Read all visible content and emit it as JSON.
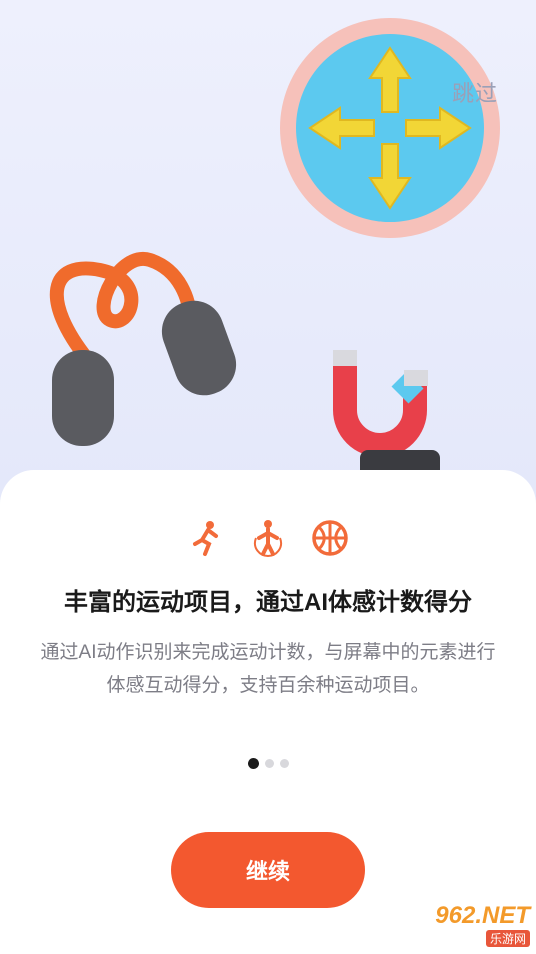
{
  "header": {
    "skip_label": "跳过"
  },
  "feature_icons": [
    "running-icon",
    "jump-rope-icon",
    "basketball-icon"
  ],
  "content": {
    "title": "丰富的运动项目，通过AI体感计数得分",
    "description": "通过AI动作识别来完成运动计数，与屏幕中的元素进行体感互动得分，支持百余种运动项目。"
  },
  "pager": {
    "total": 3,
    "active_index": 0
  },
  "actions": {
    "continue_label": "继续"
  },
  "watermark": {
    "top": "962.NET",
    "bottom": "乐游网"
  },
  "colors": {
    "accent": "#f3582f",
    "hero_bg": "#eef0fd",
    "icon_orange": "#f26b3a"
  }
}
